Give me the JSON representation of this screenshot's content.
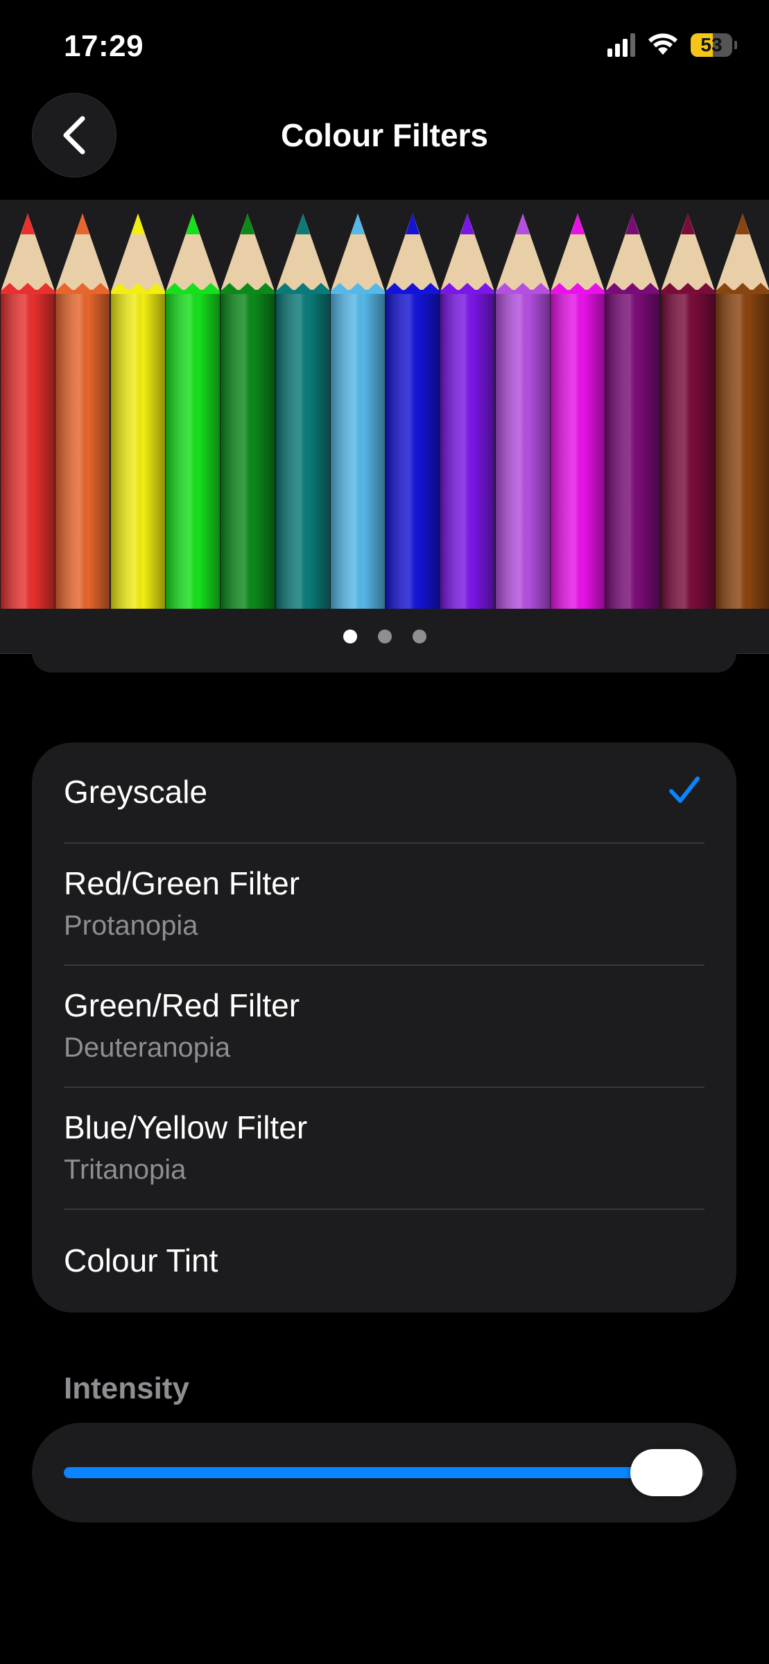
{
  "status_bar": {
    "time": "17:29",
    "battery_level": "53",
    "battery_fraction": 0.53,
    "battery_color": "#f5c518",
    "signal_bars_on": 3,
    "signal_bars_total": 4
  },
  "nav": {
    "back_icon": "chevron-left-icon",
    "title": "Colour Filters"
  },
  "preview": {
    "pencil_colors": [
      "#e8302e",
      "#e8662c",
      "#f2ee12",
      "#16e01c",
      "#0b8a1a",
      "#0b7a78",
      "#55b8e8",
      "#1414d8",
      "#7a16e6",
      "#b44fe0",
      "#e812e8",
      "#7a0c78",
      "#7a0c3a",
      "#8a4410"
    ],
    "page_count": 3,
    "active_page": 1
  },
  "filters": {
    "items": [
      {
        "label": "Greyscale",
        "subtitle": "",
        "selected": true
      },
      {
        "label": "Red/Green Filter",
        "subtitle": "Protanopia",
        "selected": false
      },
      {
        "label": "Green/Red Filter",
        "subtitle": "Deuteranopia",
        "selected": false
      },
      {
        "label": "Blue/Yellow Filter",
        "subtitle": "Tritanopia",
        "selected": false
      },
      {
        "label": "Colour Tint",
        "subtitle": "",
        "selected": false
      }
    ],
    "check_icon": "checkmark-icon",
    "accent_color": "#0a84ff"
  },
  "intensity": {
    "header": "Intensity",
    "value": 0.94,
    "accent_color": "#0a84ff"
  }
}
